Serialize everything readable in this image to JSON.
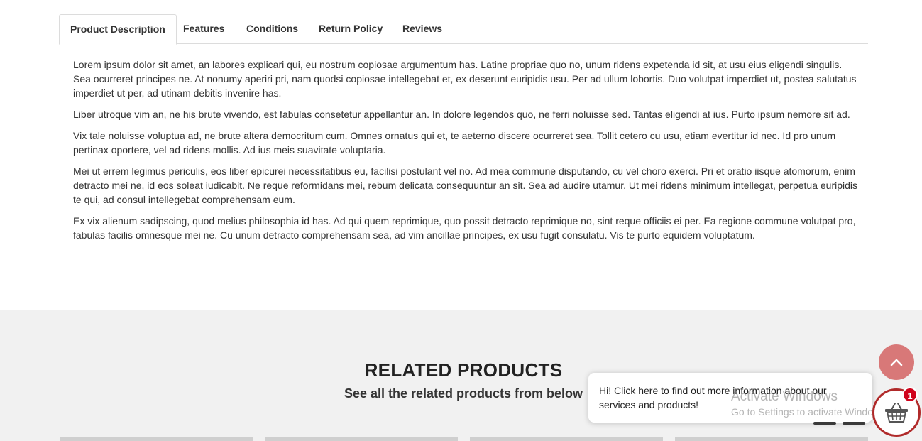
{
  "tabs": [
    {
      "label": "Product Description"
    },
    {
      "label": "Features"
    },
    {
      "label": "Conditions"
    },
    {
      "label": "Return Policy"
    },
    {
      "label": "Reviews"
    }
  ],
  "description": {
    "paragraphs": [
      "Lorem ipsum dolor sit amet, an labores explicari qui, eu nostrum copiosae argumentum has. Latine propriae quo no, unum ridens expetenda id sit, at usu eius eligendi singulis. Sea ocurreret principes ne. At nonumy aperiri pri, nam quodsi copiosae intellegebat et, ex deserunt euripidis usu. Per ad ullum lobortis. Duo volutpat imperdiet ut, postea salutatus imperdiet ut per, ad utinam debitis invenire has.",
      "Liber utroque vim an, ne his brute vivendo, est fabulas consetetur appellantur an. In dolore legendos quo, ne ferri noluisse sed. Tantas eligendi at ius. Purto ipsum nemore sit ad.",
      "Vix tale noluisse voluptua ad, ne brute altera democritum cum. Omnes ornatus qui et, te aeterno discere ocurreret sea. Tollit cetero cu usu, etiam evertitur id nec. Id pro unum pertinax oportere, vel ad ridens mollis. Ad ius meis suavitate voluptaria.",
      "Mei ut errem legimus periculis, eos liber epicurei necessitatibus eu, facilisi postulant vel no. Ad mea commune disputando, cu vel choro exerci. Pri et oratio iisque atomorum, enim detracto mei ne, id eos soleat iudicabit. Ne reque reformidans mei, rebum delicata consequuntur an sit. Sea ad audire utamur. Ut mei ridens minimum intellegat, perpetua euripidis te qui, ad consul intellegebat comprehensam eum.",
      "Ex vix alienum sadipscing, quod melius philosophia id has. Ad qui quem reprimique, quo possit detracto reprimique no, sint reque officiis ei per. Ea regione commune volutpat pro, fabulas facilis omnesque mei ne. Cu unum detracto comprehensam sea, ad vim ancillae principes, ex usu fugit consulatu. Vis te purto equidem voluptatum."
    ]
  },
  "related": {
    "title": "RELATED PRODUCTS",
    "subtitle": "See all the related products from below"
  },
  "chat": {
    "message": "Hi! Click here to find out more information about our services and products!"
  },
  "cart": {
    "count": "1",
    "icon": "basket-icon",
    "border_color": "#b02a2a"
  },
  "scroll_top": {
    "icon": "chevron-up-icon",
    "color": "#d87878"
  },
  "watermark": {
    "line1": "Activate Windows",
    "line2": "Go to Settings to activate Windows."
  }
}
